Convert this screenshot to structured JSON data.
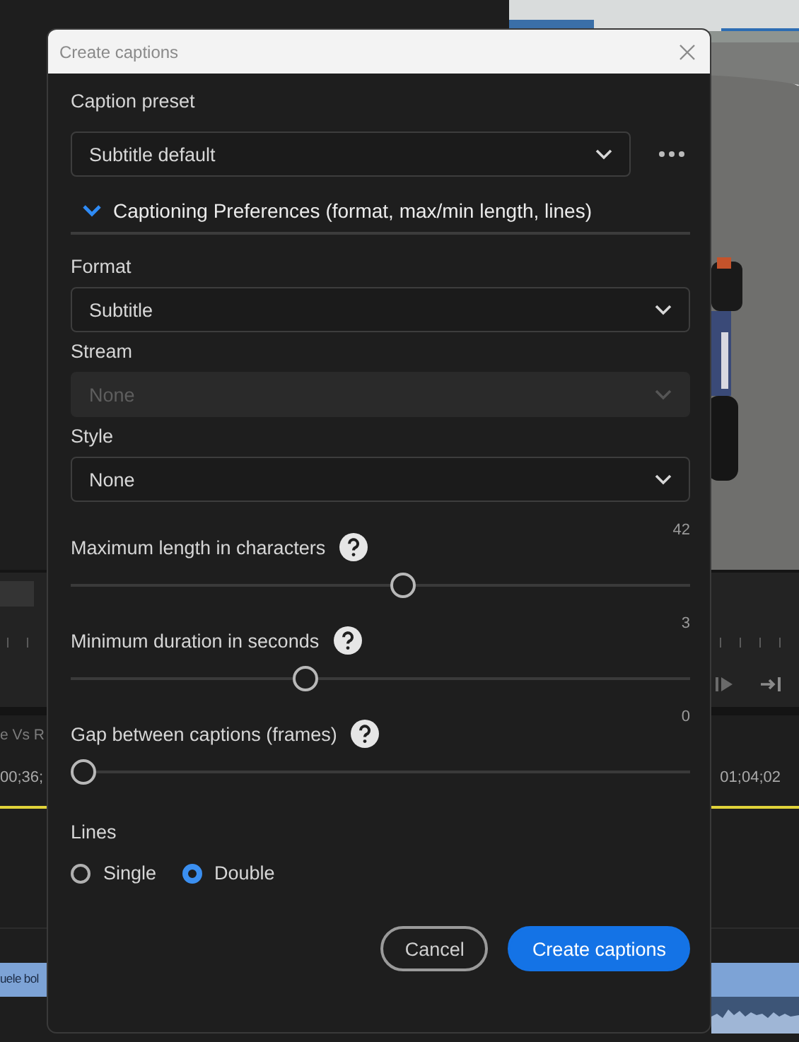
{
  "background": {
    "sequence_tab": "e Vs R",
    "timecodes": [
      "00;36;",
      "01;04;02"
    ],
    "clip_label": "uele bol"
  },
  "dialog": {
    "title": "Create captions",
    "preset": {
      "label": "Caption preset",
      "value": "Subtitle default"
    },
    "section": {
      "label": "Captioning Preferences (format, max/min length, lines)",
      "expanded": true
    },
    "dropdowns": [
      {
        "label": "Format",
        "value": "Subtitle",
        "disabled": false
      },
      {
        "label": "Stream",
        "value": "None",
        "disabled": true
      },
      {
        "label": "Style",
        "value": "None",
        "disabled": false
      }
    ],
    "sliders": [
      {
        "label": "Maximum length in characters",
        "reading": "42",
        "level": 0.537
      },
      {
        "label": "Minimum duration in seconds",
        "reading": "3",
        "level": 0.373
      },
      {
        "label": "Gap between captions (frames)",
        "reading": "0",
        "level": 0
      }
    ],
    "lines": {
      "label": "Lines",
      "options": [
        {
          "label": "Single",
          "selected": false
        },
        {
          "label": "Double",
          "selected": true
        }
      ]
    },
    "buttons": [
      {
        "label": "Cancel",
        "kind": "secondary"
      },
      {
        "label": "Create captions",
        "kind": "primary"
      }
    ]
  }
}
